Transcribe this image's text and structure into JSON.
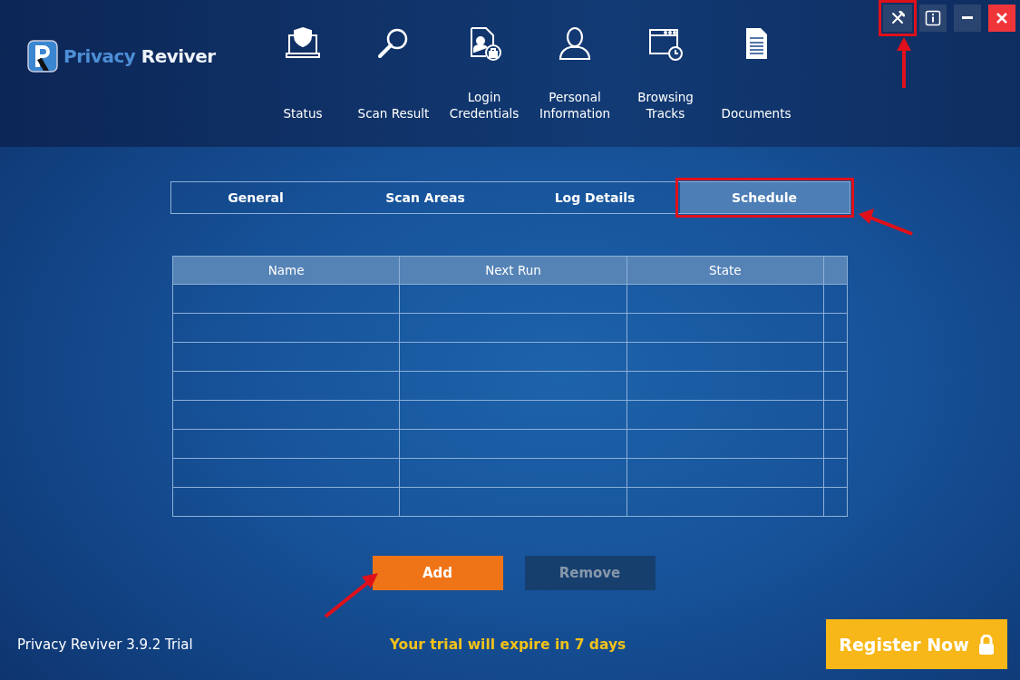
{
  "logo": {
    "word_1": "Privacy",
    "word_2": "Reviver"
  },
  "nav": [
    {
      "label": "Status"
    },
    {
      "label": "Scan Result"
    },
    {
      "label": "Login\nCredentials"
    },
    {
      "label": "Personal\nInformation"
    },
    {
      "label": "Browsing\nTracks"
    },
    {
      "label": "Documents"
    }
  ],
  "window_controls": [
    {
      "kind": "tools",
      "highlighted": true
    },
    {
      "kind": "info",
      "highlighted": false
    },
    {
      "kind": "minimize",
      "highlighted": false
    },
    {
      "kind": "close",
      "highlighted": false
    }
  ],
  "tabs": [
    {
      "label": "General",
      "selected": false,
      "highlighted": false
    },
    {
      "label": "Scan Areas",
      "selected": false,
      "highlighted": false
    },
    {
      "label": "Log Details",
      "selected": false,
      "highlighted": false
    },
    {
      "label": "Schedule",
      "selected": true,
      "highlighted": true
    }
  ],
  "table": {
    "columns": [
      "Name",
      "Next Run",
      "State"
    ]
  },
  "buttons": [
    {
      "label": "Add",
      "disabled": false
    },
    {
      "label": "Remove",
      "disabled": true
    }
  ],
  "footer": {
    "version": "Privacy Reviver 3.9.2 Trial",
    "trial_notice": "Your trial will expire in 7 days",
    "register_button": "Register Now"
  }
}
